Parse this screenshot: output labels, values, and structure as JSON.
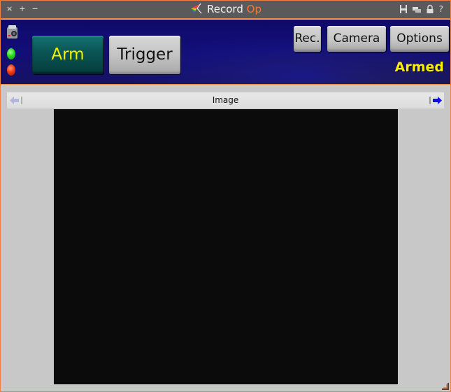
{
  "window": {
    "title_main": "Record",
    "title_accent": "Op",
    "controls_left": [
      "×",
      "+",
      "−"
    ],
    "controls_right": [
      "save-icon",
      "windows-icon",
      "lock-icon",
      "help-icon"
    ],
    "help_glyph": "?"
  },
  "panel": {
    "arm_label": "Arm",
    "trigger_label": "Trigger",
    "rec_label": "Rec.",
    "camera_label": "Camera",
    "options_label": "Options",
    "status": "Armed",
    "status_color": "#f8f000",
    "leds": [
      {
        "name": "green",
        "color": "#30e020"
      },
      {
        "name": "red",
        "color": "#f03a10"
      }
    ]
  },
  "viewer": {
    "title": "Image",
    "prev_enabled": false,
    "next_enabled": true
  },
  "colors": {
    "accent": "#f07a3a",
    "panel_bg": "#120e78",
    "arm_bg": "#0a5656"
  }
}
